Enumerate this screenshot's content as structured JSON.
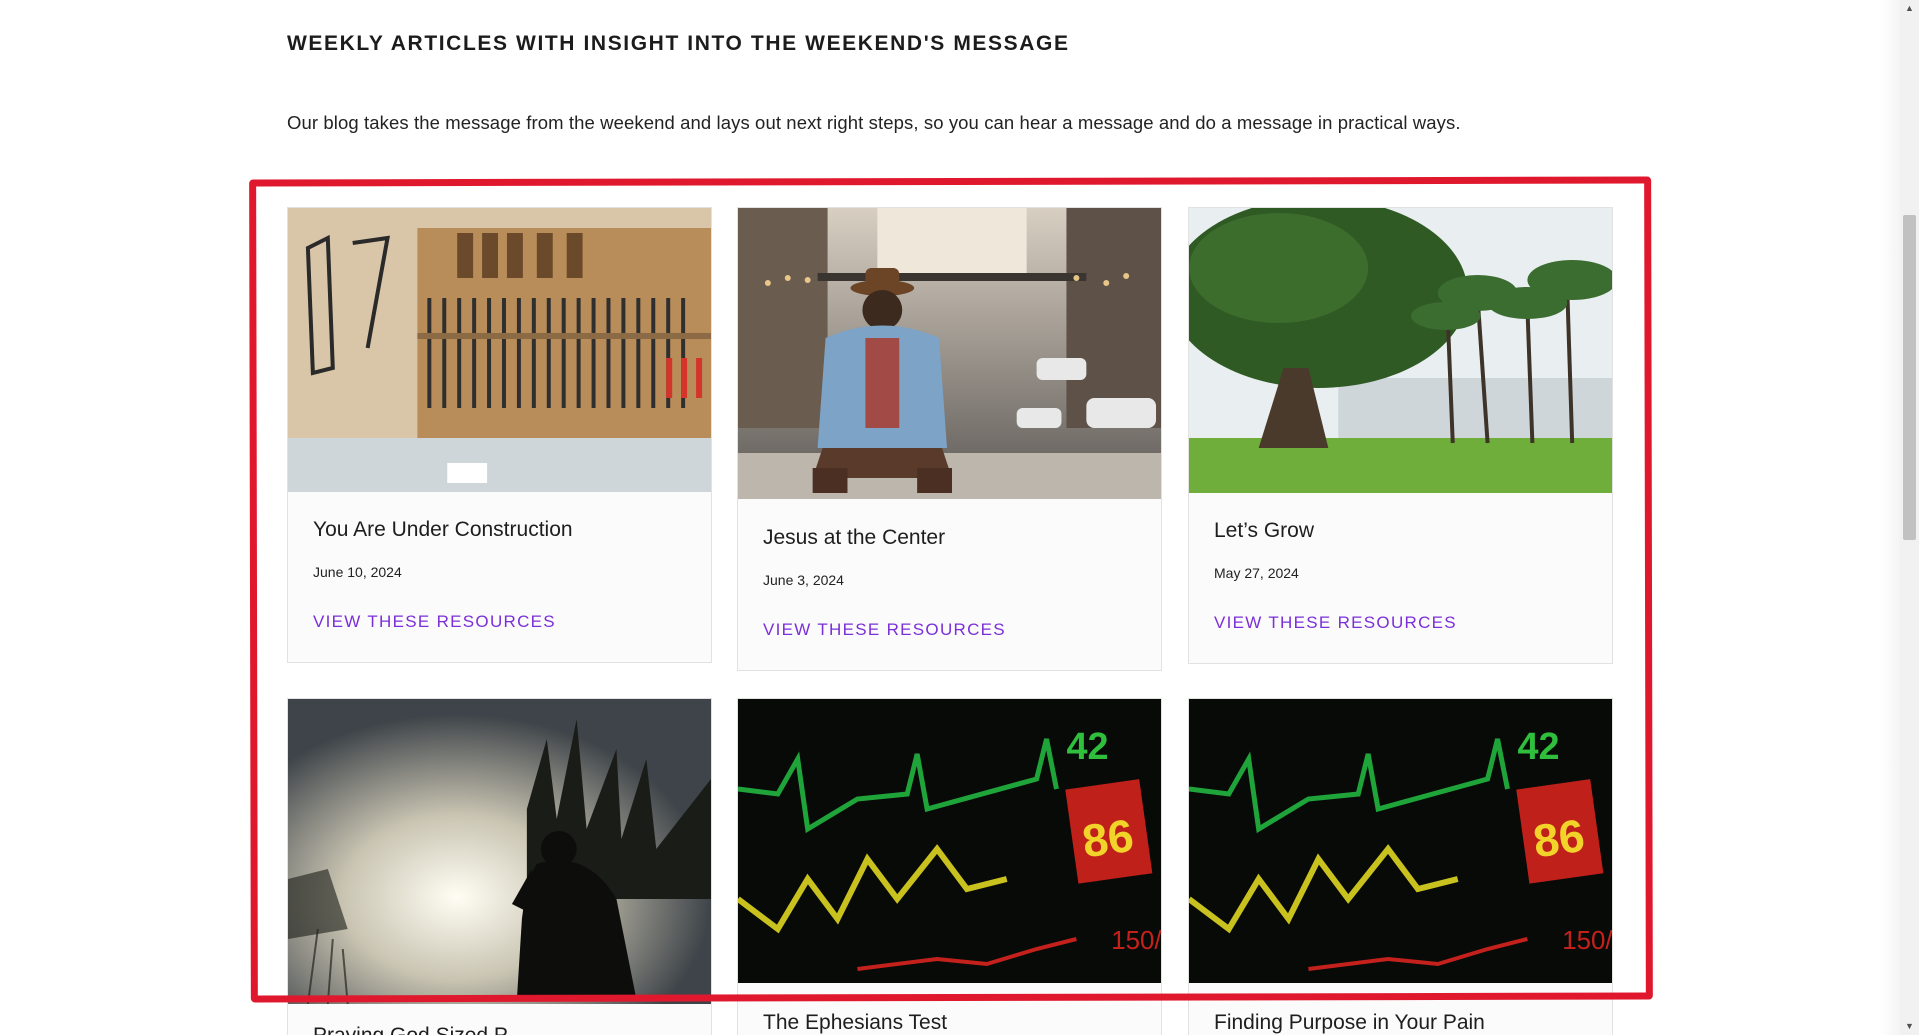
{
  "section": {
    "heading": "WEEKLY ARTICLES WITH INSIGHT INTO THE WEEKEND'S MESSAGE",
    "intro": "Our blog takes the message from the weekend and lays out next right steps, so you can hear a message and do a message in practical ways."
  },
  "cards": [
    {
      "title": "You Are Under Construction",
      "date": "June 10, 2024",
      "link": "VIEW THESE RESOURCES",
      "image": "tools-on-wall-image"
    },
    {
      "title": "Jesus at the Center",
      "date": "June 3, 2024",
      "link": "VIEW THESE RESOURCES",
      "image": "man-sitting-city-street-image"
    },
    {
      "title": "Let’s Grow",
      "date": "May 27, 2024",
      "link": "VIEW THESE RESOURCES",
      "image": "tree-and-palms-park-image"
    },
    {
      "title": "Praying God Sized P...",
      "image": "silhouette-praying-fog-image"
    },
    {
      "title": "The Ephesians Test",
      "image": "heart-monitor-image"
    },
    {
      "title": "Finding Purpose in Your Pain",
      "image": "heart-monitor-image"
    }
  ],
  "monitor": {
    "bpm": "42",
    "value": "86",
    "bp": "150/"
  },
  "colors": {
    "link": "#7b2fd8",
    "highlight": "#e0182d"
  }
}
